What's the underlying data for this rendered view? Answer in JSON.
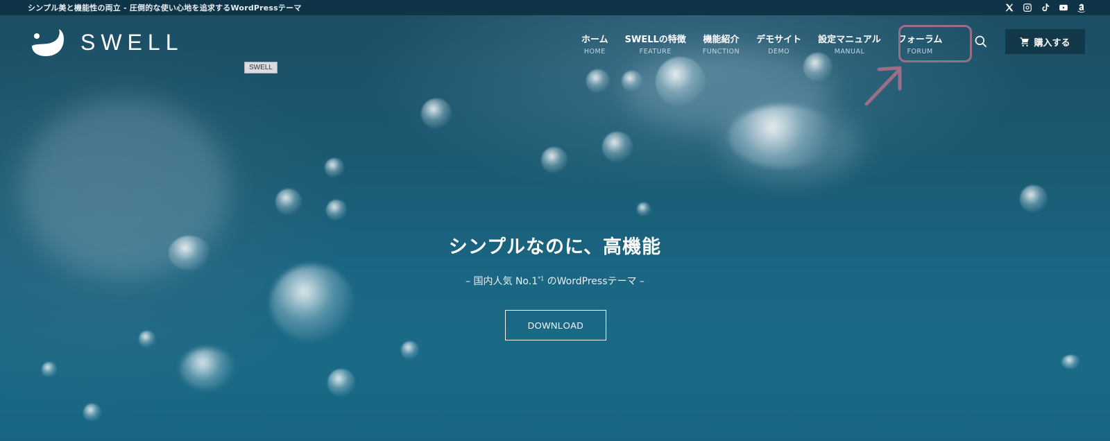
{
  "topbar": {
    "tagline": "シンプル美と機能性の両立 - 圧倒的な使い心地を追求するWordPressテーマ",
    "social_icons": [
      "x-icon",
      "instagram-icon",
      "tiktok-icon",
      "youtube-icon",
      "amazon-icon"
    ]
  },
  "header": {
    "logo_text": "SWELL",
    "nav": [
      {
        "jp": "ホーム",
        "en": "HOME"
      },
      {
        "jp": "SWELLの特徴",
        "en": "FEATURE"
      },
      {
        "jp": "機能紹介",
        "en": "FUNCTION"
      },
      {
        "jp": "デモサイト",
        "en": "DEMO"
      },
      {
        "jp": "設定マニュアル",
        "en": "MANUAL"
      },
      {
        "jp": "フォーラム",
        "en": "FORUM"
      }
    ],
    "buy_label": "購入する"
  },
  "tooltip_tag": "SWELL",
  "hero": {
    "title": "シンプルなのに、高機能",
    "subtitle_prefix": "– 国内人気 No.1",
    "subtitle_sup": "*1",
    "subtitle_suffix": " のWordPressテーマ –",
    "download_label": "DOWNLOAD"
  },
  "colors": {
    "topbar_bg": "#0f3447",
    "buy_bg": "#12384a",
    "highlight": "#9a6f86"
  }
}
